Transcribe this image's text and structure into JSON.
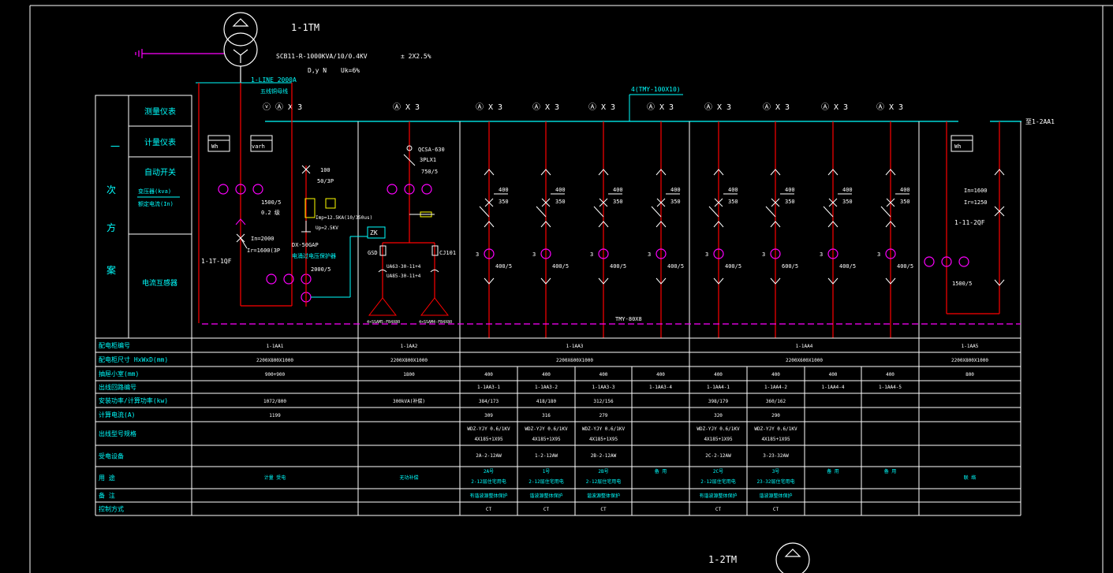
{
  "colors": {
    "background": "#000000",
    "frame": "#ffffff",
    "bus": "#00ffff",
    "feeder": "#ff0000",
    "meter": "#ff00ff",
    "ground_dash": "#ff00ff",
    "annotation": "#00ffff",
    "switch_symbol": "#ffff00"
  },
  "transformer": {
    "tag": "1-1TM",
    "model": "SCB11-R-1000KVA/10/0.4KV",
    "tap": "± 2X2.5%",
    "connection": "D,y N",
    "impedance": "Uk=6%",
    "line": "1-LINE 2000A",
    "line_note": "五线铜母线"
  },
  "transformer2": {
    "tag": "1-2TM"
  },
  "left_labels": {
    "main": [
      "一",
      "次",
      "方",
      "案"
    ],
    "rows": [
      "测量仪表",
      "计量仪表",
      "自动开关",
      "电流互感器"
    ],
    "sub1": "变压器(kva)",
    "sub2": "额定电流(In)"
  },
  "meter_groups": [
    "ⓥ Ⓐ X 3",
    "Ⓐ X 3",
    "Ⓐ X 3",
    "Ⓐ X 3",
    "Ⓐ X 3",
    "Ⓐ X 3",
    "Ⓐ X 3",
    "Ⓐ X 3",
    "Ⓐ X 3",
    "Ⓐ X 3"
  ],
  "busbar_label": "4(TMY-100X10)",
  "bus_end_label": "至1-2AA1",
  "panel_labels": {
    "wh": "Wh",
    "varh": "varh",
    "inc_ct": "1500/5",
    "inc_class": "0.2 级",
    "inc_breaker": "In=2000",
    "inc_trip": "Ir=1600(3P",
    "inc_tag": "1-1T-1QF",
    "cap_breaker": "100",
    "cap_pole": "50/3P",
    "spd1": "Imp=12.5KA(10/350us)",
    "spd2": "Up=2.5KV",
    "spd_model": "DX-50GAP",
    "spd_note": "电涌过电压保护器",
    "ct2": "2000/5",
    "zk": "ZK",
    "cap_switch": "QCSA-630",
    "cap_fuse": "3PLX1",
    "cap_ct": "750/5",
    "gsd": "GSD",
    "cjt": "CJ101",
    "c1": "UA63-30-11+4",
    "c2": "UA85-30-11+4",
    "bank1": "4×SSAM5-FB4X80",
    "bank2": "4×SSAM4-FB4X80",
    "bus_bottom": "TMY-80X8",
    "out_tag": "1-11-2QF",
    "out_in": "In=1600",
    "out_ir": "Ir=1250",
    "out_ct": "1500/5"
  },
  "feeders": [
    {
      "frame": "400",
      "trip": "350",
      "ct": "400/5"
    },
    {
      "frame": "400",
      "trip": "350",
      "ct": "400/5"
    },
    {
      "frame": "400",
      "trip": "350",
      "ct": "400/5"
    },
    {
      "frame": "400",
      "trip": "350",
      "ct": "400/5"
    },
    {
      "frame": "400",
      "trip": "350",
      "ct": "400/5"
    },
    {
      "frame": "400",
      "trip": "350",
      "ct": "600/5"
    },
    {
      "frame": "400",
      "trip": "350",
      "ct": "400/5"
    },
    {
      "frame": "400",
      "trip": "350",
      "ct": "400/5"
    }
  ],
  "table": {
    "row_labels": [
      "配电柜编号",
      "配电柜尺寸  HxWxD(mm)",
      "抽屉小室(mm)",
      "出线回路编号",
      "安装功率/计算功率(kw)",
      "计算电流(A)",
      "出线型号规格",
      "受电设备",
      "用 途",
      "备 注",
      "控制方式"
    ],
    "panel_numbers": [
      "1-1AA1",
      "1-1AA2",
      "1-1AA3",
      "1-1AA4",
      "1-1AA5"
    ],
    "panel_sizes": [
      "2200X800X1000",
      "2200X800X1000",
      "2200X600X1000",
      "2200X600X1000",
      "2200X800X1000"
    ],
    "drawer_incoming": "900+900",
    "drawer_capacitor": "1800",
    "drawers": [
      "400",
      "400",
      "400",
      "400",
      "400",
      "400",
      "400",
      "400"
    ],
    "drawer_outgoing": "800",
    "circuits": [
      "1-1AA3-1",
      "1-1AA3-2",
      "1-1AA3-3",
      "1-1AA3-4",
      "1-1AA4-1",
      "1-1AA4-2",
      "1-1AA4-4",
      "1-1AA4-5"
    ],
    "power_incoming": "1072/800",
    "power_capacitor": "300kVA(补偿)",
    "powers": [
      "384/173",
      "418/180",
      "312/156",
      "",
      "398/179",
      "360/162",
      "",
      ""
    ],
    "current_incoming": "1199",
    "currents": [
      "309",
      "316",
      "279",
      "",
      "320",
      "290",
      "",
      ""
    ],
    "cable_a": [
      "WDZ-YJY 0.6/1KV",
      "WDZ-YJY 0.6/1KV",
      "WDZ-YJY 0.6/1KV",
      "",
      "WDZ-YJY 0.6/1KV",
      "WDZ-YJY 0.6/1KV",
      "",
      ""
    ],
    "cable_b": [
      "4X185+1X95",
      "4X185+1X95",
      "4X185+1X95",
      "",
      "4X185+1X95",
      "4X185+1X95",
      "",
      ""
    ],
    "equipment": [
      "2A-2-12AW",
      "1-2-12AW",
      "2B-2-12AW",
      "",
      "2C-2-12AW",
      "3-23-32AW",
      "",
      ""
    ],
    "use_incoming": "计量  受电",
    "use_capacitor": "无功补偿",
    "use_a": [
      "2A号",
      "1号",
      "2B号",
      "备 用",
      "2C号",
      "3号",
      "备 用",
      "备 用"
    ],
    "use_b": [
      "2-12层住宅用电",
      "2-12层住宅用电",
      "2-12层住宅用电",
      "",
      "2-12层住宅用电",
      "23-32层住宅用电",
      "",
      ""
    ],
    "use_outgoing": "联 络",
    "remarks": [
      "有谐波源整体保护",
      "谐波源整体保护",
      "谐波源整体保护",
      "",
      "有谐波源整体保护",
      "谐波源整体保护",
      "",
      ""
    ],
    "control": [
      "CT",
      "CT",
      "CT",
      "",
      "CT",
      "CT",
      "",
      ""
    ]
  }
}
